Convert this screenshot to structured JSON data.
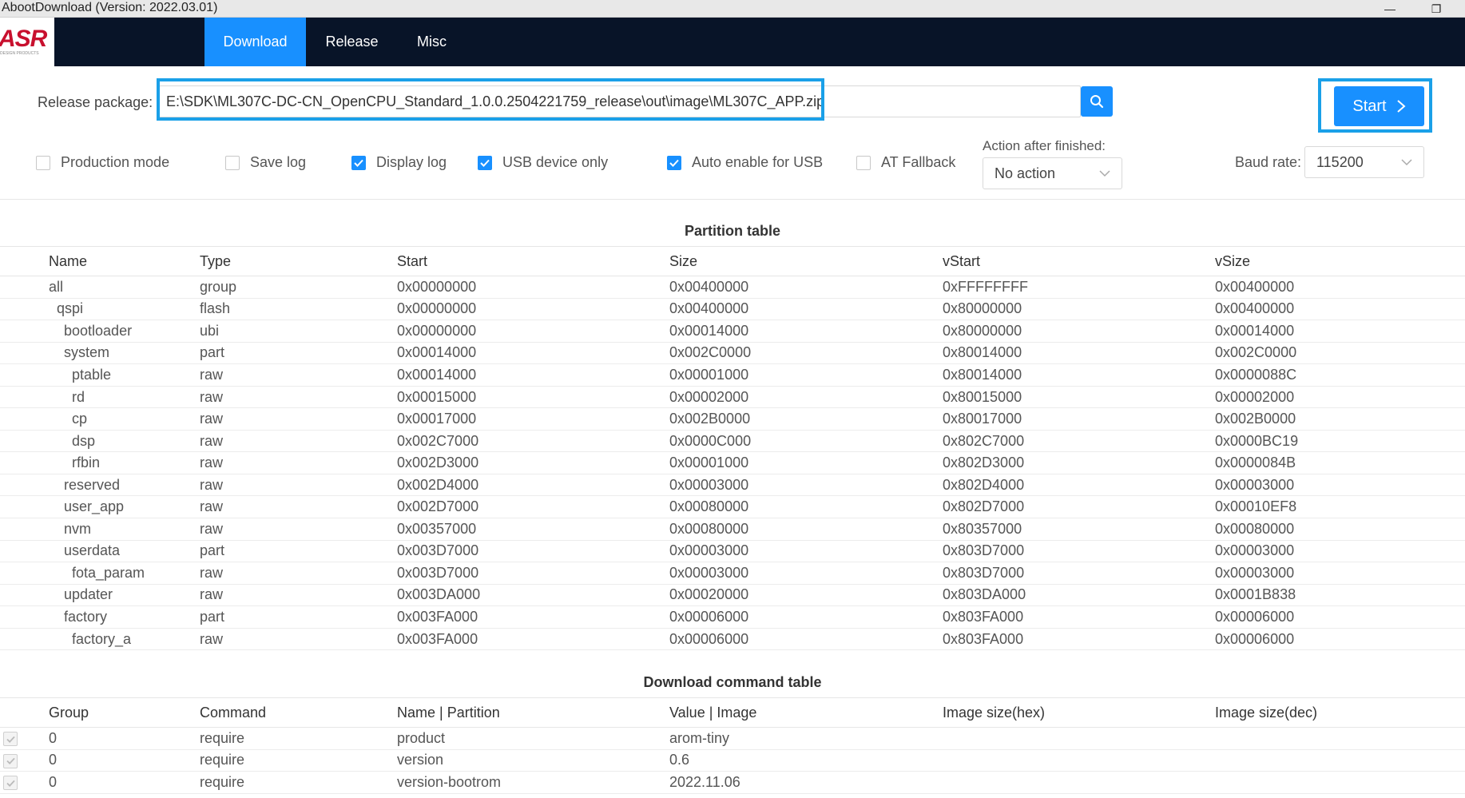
{
  "window": {
    "title": "AbootDownload (Version: 2022.03.01)",
    "minimize": "—",
    "maximize": "❐"
  },
  "header": {
    "logo_text": "ASR",
    "logo_sub": "DESIGN PRODUCTS",
    "tabs": [
      "Download",
      "Release",
      "Misc"
    ],
    "active_tab": "Download",
    "active_color": "#1890ff",
    "bg_color": "#081428"
  },
  "release": {
    "label": "Release package:",
    "value": "E:\\SDK\\ML307C-DC-CN_OpenCPU_Standard_1.0.0.2504221759_release\\out\\image\\ML307C_APP.zip",
    "search_icon": "search-icon",
    "start_label": "Start",
    "start_icon": "chevron-right-icon"
  },
  "options": {
    "items": [
      {
        "label": "Production mode",
        "checked": false
      },
      {
        "label": "Save log",
        "checked": false
      },
      {
        "label": "Display log",
        "checked": true
      },
      {
        "label": "USB device only",
        "checked": true
      },
      {
        "label": "Auto enable for USB",
        "checked": true
      },
      {
        "label": "AT Fallback",
        "checked": false
      }
    ],
    "action_label": "Action after finished:",
    "action_value": "No action",
    "baud_label": "Baud rate:",
    "baud_value": "115200"
  },
  "partition_table": {
    "title": "Partition table",
    "columns": [
      "Name",
      "Type",
      "Start",
      "Size",
      "vStart",
      "vSize"
    ],
    "rows": [
      [
        "all",
        "group",
        "0x00000000",
        "0x00400000",
        "0xFFFFFFFF",
        "0x00400000"
      ],
      [
        "qspi",
        "flash",
        "0x00000000",
        "0x00400000",
        "0x80000000",
        "0x00400000"
      ],
      [
        "bootloader",
        "ubi",
        "0x00000000",
        "0x00014000",
        "0x80000000",
        "0x00014000"
      ],
      [
        "system",
        "part",
        "0x00014000",
        "0x002C0000",
        "0x80014000",
        "0x002C0000"
      ],
      [
        "ptable",
        "raw",
        "0x00014000",
        "0x00001000",
        "0x80014000",
        "0x0000088C"
      ],
      [
        "rd",
        "raw",
        "0x00015000",
        "0x00002000",
        "0x80015000",
        "0x00002000"
      ],
      [
        "cp",
        "raw",
        "0x00017000",
        "0x002B0000",
        "0x80017000",
        "0x002B0000"
      ],
      [
        "dsp",
        "raw",
        "0x002C7000",
        "0x0000C000",
        "0x802C7000",
        "0x0000BC19"
      ],
      [
        "rfbin",
        "raw",
        "0x002D3000",
        "0x00001000",
        "0x802D3000",
        "0x0000084B"
      ],
      [
        "reserved",
        "raw",
        "0x002D4000",
        "0x00003000",
        "0x802D4000",
        "0x00003000"
      ],
      [
        "user_app",
        "raw",
        "0x002D7000",
        "0x00080000",
        "0x802D7000",
        "0x00010EF8"
      ],
      [
        "nvm",
        "raw",
        "0x00357000",
        "0x00080000",
        "0x80357000",
        "0x00080000"
      ],
      [
        "userdata",
        "part",
        "0x003D7000",
        "0x00003000",
        "0x803D7000",
        "0x00003000"
      ],
      [
        "fota_param",
        "raw",
        "0x003D7000",
        "0x00003000",
        "0x803D7000",
        "0x00003000"
      ],
      [
        "updater",
        "raw",
        "0x003DA000",
        "0x00020000",
        "0x803DA000",
        "0x0001B838"
      ],
      [
        "factory",
        "part",
        "0x003FA000",
        "0x00006000",
        "0x803FA000",
        "0x00006000"
      ],
      [
        "factory_a",
        "raw",
        "0x003FA000",
        "0x00006000",
        "0x803FA000",
        "0x00006000"
      ]
    ],
    "indent_levels": [
      0,
      1,
      2,
      2,
      3,
      3,
      3,
      3,
      3,
      2,
      2,
      2,
      2,
      3,
      2,
      2,
      3
    ]
  },
  "command_table": {
    "title": "Download command table",
    "columns": [
      "Group",
      "Command",
      "Name | Partition",
      "Value | Image",
      "Image size(hex)",
      "Image size(dec)"
    ],
    "rows": [
      [
        "0",
        "require",
        "product",
        "arom-tiny",
        "",
        ""
      ],
      [
        "0",
        "require",
        "version",
        "0.6",
        "",
        ""
      ],
      [
        "0",
        "require",
        "version-bootrom",
        "2022.11.06",
        "",
        ""
      ]
    ]
  }
}
